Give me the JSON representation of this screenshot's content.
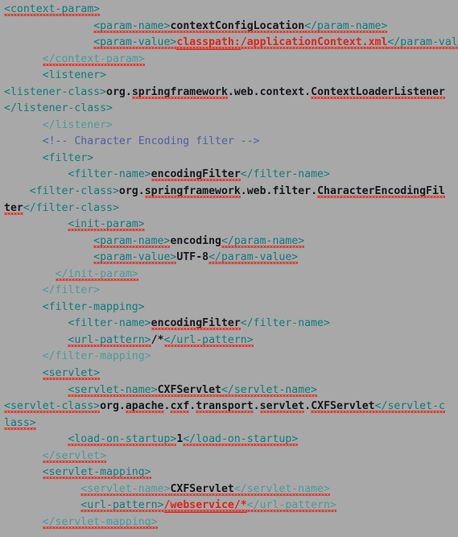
{
  "editor": {
    "language": "xml",
    "file_kind": "web.xml deployment descriptor",
    "background_color": "#a8a8a8",
    "colors": {
      "tag": "#107b7e",
      "tag_dim": "#4c9a9c",
      "text": "#16181f",
      "red": "#e0231a",
      "comment": "#4a5fa8",
      "spellcheck_underline": "#ee2a1e"
    }
  },
  "lines": [
    {
      "indent": 0,
      "segments": [
        {
          "t": "<context-param>",
          "c": "tag",
          "u": "squiggle"
        }
      ]
    },
    {
      "indent": 7,
      "segments": [
        {
          "t": "<param-name>",
          "c": "tag",
          "u": "squiggle"
        },
        {
          "t": "contextConfigLocation",
          "c": "text",
          "u": "squiggle"
        },
        {
          "t": "</param-name>",
          "c": "tag",
          "u": "squiggle"
        }
      ]
    },
    {
      "indent": 7,
      "segments": [
        {
          "t": "<param-value>",
          "c": "tag",
          "u": "squiggle"
        },
        {
          "t": "classpath:",
          "c": "red",
          "u": "solid-squiggle"
        },
        {
          "t": "/applicationContext.",
          "c": "red",
          "u": "squiggle"
        },
        {
          "t": "xml",
          "c": "red",
          "u": "squiggle"
        },
        {
          "t": "</param-value>",
          "c": "tag",
          "u": "squiggle"
        }
      ]
    },
    {
      "indent": 3,
      "segments": [
        {
          "t": "</context-param>",
          "c": "tag-dim",
          "u": "squiggle"
        }
      ]
    },
    {
      "indent": 3,
      "segments": [
        {
          "t": "<listener>",
          "c": "tag",
          "u": "none"
        }
      ]
    },
    {
      "indent": 0,
      "segments": [
        {
          "t": "<listener-class>",
          "c": "tag",
          "u": "none"
        },
        {
          "t": "org.",
          "c": "text",
          "u": "none"
        },
        {
          "t": "springframework",
          "c": "text",
          "u": "squiggle"
        },
        {
          "t": ".web.context.",
          "c": "text",
          "u": "none"
        },
        {
          "t": "ContextLoaderListener",
          "c": "text",
          "u": "squiggle"
        }
      ]
    },
    {
      "indent": 0,
      "segments": [
        {
          "t": "</listener-class>",
          "c": "tag",
          "u": "none"
        }
      ]
    },
    {
      "indent": 3,
      "segments": [
        {
          "t": "</listener>",
          "c": "tag-dim",
          "u": "none"
        }
      ]
    },
    {
      "indent": 3,
      "segments": [
        {
          "t": "<!-- Character Encoding filter -->",
          "c": "comment",
          "u": "none"
        }
      ]
    },
    {
      "indent": 3,
      "segments": [
        {
          "t": "<filter>",
          "c": "tag",
          "u": "none"
        }
      ]
    },
    {
      "indent": 5,
      "segments": [
        {
          "t": "<filter-name>",
          "c": "tag",
          "u": "none"
        },
        {
          "t": "encodingFilter",
          "c": "text",
          "u": "squiggle"
        },
        {
          "t": "</filter-name>",
          "c": "tag",
          "u": "none"
        }
      ]
    },
    {
      "indent": 2,
      "segments": [
        {
          "t": "<filter-class>",
          "c": "tag",
          "u": "none"
        },
        {
          "t": "org.",
          "c": "text",
          "u": "none"
        },
        {
          "t": "springframework",
          "c": "text",
          "u": "squiggle"
        },
        {
          "t": ".web.filter.",
          "c": "text",
          "u": "none"
        },
        {
          "t": "CharacterEncodingFil",
          "c": "text",
          "u": "squiggle"
        }
      ]
    },
    {
      "indent": 0,
      "segments": [
        {
          "t": "ter",
          "c": "text",
          "u": "squiggle"
        },
        {
          "t": "</filter-class>",
          "c": "tag",
          "u": "none"
        }
      ]
    },
    {
      "indent": 5,
      "segments": [
        {
          "t": "<init-param>",
          "c": "tag",
          "u": "squiggle"
        }
      ]
    },
    {
      "indent": 7,
      "segments": [
        {
          "t": "<param-name>",
          "c": "tag",
          "u": "squiggle"
        },
        {
          "t": "encoding",
          "c": "text",
          "u": "none"
        },
        {
          "t": "</param-name>",
          "c": "tag",
          "u": "squiggle"
        }
      ]
    },
    {
      "indent": 7,
      "segments": [
        {
          "t": "<param-value>",
          "c": "tag",
          "u": "squiggle"
        },
        {
          "t": "UTF-8",
          "c": "text",
          "u": "none"
        },
        {
          "t": "</param-value>",
          "c": "tag",
          "u": "squiggle"
        }
      ]
    },
    {
      "indent": 4,
      "segments": [
        {
          "t": "</init-param>",
          "c": "tag-dim",
          "u": "squiggle"
        }
      ]
    },
    {
      "indent": 3,
      "segments": [
        {
          "t": "</filter>",
          "c": "tag-dim",
          "u": "none"
        }
      ]
    },
    {
      "indent": 3,
      "segments": [
        {
          "t": "<filter-mapping>",
          "c": "tag",
          "u": "none"
        }
      ]
    },
    {
      "indent": 5,
      "segments": [
        {
          "t": "<filter-name>",
          "c": "tag",
          "u": "none"
        },
        {
          "t": "encodingFilter",
          "c": "text",
          "u": "squiggle"
        },
        {
          "t": "</filter-name>",
          "c": "tag",
          "u": "none"
        }
      ]
    },
    {
      "indent": 5,
      "segments": [
        {
          "t": "<url-pattern>",
          "c": "tag",
          "u": "squiggle"
        },
        {
          "t": "/*",
          "c": "text",
          "u": "none"
        },
        {
          "t": "</url-pattern>",
          "c": "tag",
          "u": "squiggle"
        }
      ]
    },
    {
      "indent": 3,
      "segments": [
        {
          "t": "</filter-mapping>",
          "c": "tag-dim",
          "u": "none"
        }
      ]
    },
    {
      "indent": 3,
      "segments": [
        {
          "t": "<servlet>",
          "c": "tag",
          "u": "squiggle"
        }
      ]
    },
    {
      "indent": 5,
      "segments": [
        {
          "t": "<servlet-name>",
          "c": "tag",
          "u": "squiggle"
        },
        {
          "t": "CXFServlet",
          "c": "text",
          "u": "squiggle"
        },
        {
          "t": "</servlet-name>",
          "c": "tag",
          "u": "squiggle"
        }
      ]
    },
    {
      "indent": 0,
      "segments": [
        {
          "t": "<servlet-class>",
          "c": "tag",
          "u": "squiggle"
        },
        {
          "t": "org.",
          "c": "text",
          "u": "none"
        },
        {
          "t": "apache",
          "c": "text",
          "u": "squiggle"
        },
        {
          "t": ".",
          "c": "text",
          "u": "none"
        },
        {
          "t": "cxf",
          "c": "text",
          "u": "squiggle"
        },
        {
          "t": ".",
          "c": "text",
          "u": "none"
        },
        {
          "t": "transport",
          "c": "text",
          "u": "squiggle"
        },
        {
          "t": ".",
          "c": "text",
          "u": "none"
        },
        {
          "t": "servlet",
          "c": "text",
          "u": "squiggle"
        },
        {
          "t": ".",
          "c": "text",
          "u": "none"
        },
        {
          "t": "CXFServlet",
          "c": "text",
          "u": "squiggle"
        },
        {
          "t": "</servlet-c",
          "c": "tag",
          "u": "squiggle"
        }
      ]
    },
    {
      "indent": 0,
      "segments": [
        {
          "t": "lass>",
          "c": "tag",
          "u": "squiggle"
        }
      ]
    },
    {
      "indent": 5,
      "segments": [
        {
          "t": "<load-on-startup>",
          "c": "tag",
          "u": "squiggle"
        },
        {
          "t": "1",
          "c": "text",
          "u": "none"
        },
        {
          "t": "</load-on-startup>",
          "c": "tag",
          "u": "squiggle"
        }
      ]
    },
    {
      "indent": 3,
      "segments": [
        {
          "t": "</servlet>",
          "c": "tag-dim",
          "u": "squiggle"
        }
      ]
    },
    {
      "indent": 3,
      "segments": [
        {
          "t": "<servlet-mapping>",
          "c": "tag",
          "u": "squiggle"
        }
      ]
    },
    {
      "indent": 6,
      "segments": [
        {
          "t": "<servlet-name>",
          "c": "tag-dim",
          "u": "squiggle"
        },
        {
          "t": "CXFServlet",
          "c": "text",
          "u": "squiggle"
        },
        {
          "t": "</servlet-name>",
          "c": "tag-dim",
          "u": "squiggle"
        }
      ]
    },
    {
      "indent": 6,
      "segments": [
        {
          "t": "<url-pattern>",
          "c": "tag",
          "u": "squiggle"
        },
        {
          "t": "/webservice/*",
          "c": "red",
          "u": "solid-squiggle"
        },
        {
          "t": "</url-pattern>",
          "c": "tag-dim",
          "u": "squiggle"
        }
      ]
    },
    {
      "indent": 3,
      "segments": [
        {
          "t": "</servlet-mapping>",
          "c": "tag-dim",
          "u": "squiggle"
        }
      ]
    }
  ]
}
